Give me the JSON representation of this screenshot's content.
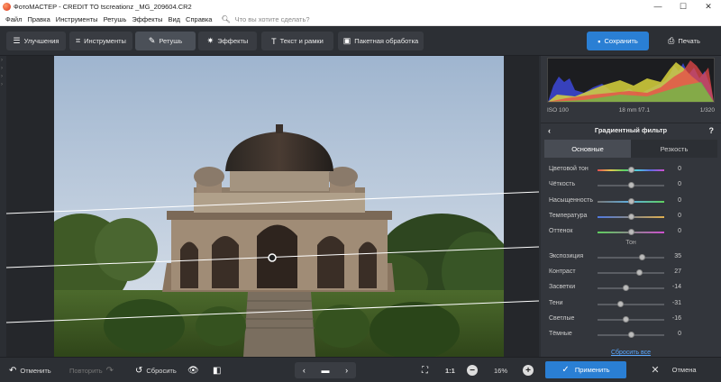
{
  "window": {
    "title": "ФотоМАСТЕР - CREDIT TO tscreationz _MG_209604.CR2",
    "controls": [
      "—",
      "☐",
      "✕"
    ]
  },
  "menu": {
    "items": [
      "Файл",
      "Правка",
      "Инструменты",
      "Ретушь",
      "Эффекты",
      "Вид",
      "Справка"
    ],
    "search_placeholder": "Что вы хотите сделать?"
  },
  "toolbar": {
    "tabs": [
      {
        "label": "Улучшения",
        "icon": "sliders-icon"
      },
      {
        "label": "Инструменты",
        "icon": "crop-icon"
      },
      {
        "label": "Ретушь",
        "icon": "brush-icon",
        "active": true
      },
      {
        "label": "Эффекты",
        "icon": "sparkle-icon"
      },
      {
        "label": "Текст и рамки",
        "icon": "text-icon"
      },
      {
        "label": "Пакетная обработка",
        "icon": "batch-icon"
      }
    ],
    "save_label": "Сохранить",
    "print_label": "Печать"
  },
  "exif": {
    "iso": "ISO 100",
    "lens": "18 mm f/7.1",
    "shutter": "1/320"
  },
  "panel": {
    "title": "Градиентный фильтр",
    "tabs": [
      "Основные",
      "Резкость"
    ],
    "color_sliders": [
      {
        "label": "Цветовой тон",
        "value": "0",
        "pos": 0.5,
        "track": "hue"
      },
      {
        "label": "Чёткость",
        "value": "0",
        "pos": 0.5,
        "track": "plain"
      },
      {
        "label": "Насыщенность",
        "value": "0",
        "pos": 0.5,
        "track": "sat"
      },
      {
        "label": "Температура",
        "value": "0",
        "pos": 0.5,
        "track": "temp"
      },
      {
        "label": "Оттенок",
        "value": "0",
        "pos": 0.5,
        "track": "tint"
      }
    ],
    "tone_title": "Тон",
    "tone_sliders": [
      {
        "label": "Экспозиция",
        "value": "35",
        "pos": 0.67
      },
      {
        "label": "Контраст",
        "value": "27",
        "pos": 0.63
      },
      {
        "label": "Засветки",
        "value": "-14",
        "pos": 0.43
      },
      {
        "label": "Тени",
        "value": "-31",
        "pos": 0.35
      },
      {
        "label": "Светлые",
        "value": "-16",
        "pos": 0.42
      },
      {
        "label": "Тёмные",
        "value": "0",
        "pos": 0.5
      }
    ],
    "reset_label": "Сбросить все"
  },
  "bottom": {
    "undo_label": "Отменить",
    "redo_label": "Повторить",
    "reset_label": "Сбросить",
    "ratio_label": "1:1",
    "zoom_label": "16%",
    "apply_label": "Применить",
    "cancel_label": "Отмена"
  },
  "colors": {
    "accent": "#2a7fd4",
    "bg": "#2b2e33",
    "panel": "#33363c"
  }
}
